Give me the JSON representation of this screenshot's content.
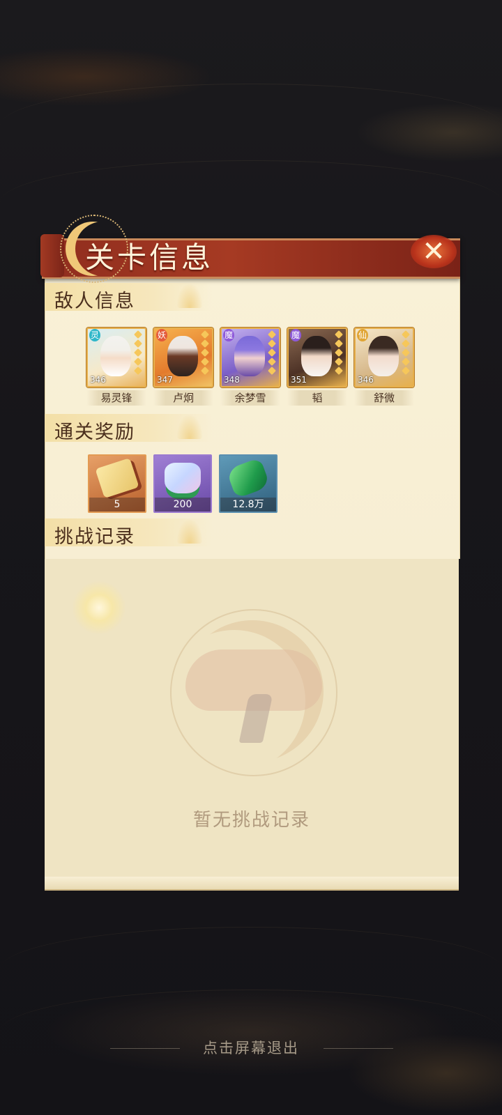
{
  "dialog": {
    "title": "关卡信息",
    "close_icon": "close-x-icon"
  },
  "enemy_section": {
    "title": "敌人信息",
    "heroes": [
      {
        "name": "易灵锋",
        "level": "346",
        "faction": "灵",
        "faction_color": "#2fb7c9"
      },
      {
        "name": "卢炯",
        "level": "347",
        "faction": "妖",
        "faction_color": "#e45a3a"
      },
      {
        "name": "余梦雪",
        "level": "348",
        "faction": "魔",
        "faction_color": "#8e5ad9"
      },
      {
        "name": "韬",
        "level": "351",
        "faction": "魔",
        "faction_color": "#8e5ad9"
      },
      {
        "name": "舒微",
        "level": "346",
        "faction": "仙",
        "faction_color": "#e0a534"
      }
    ]
  },
  "reward_section": {
    "title": "通关奖励",
    "rewards": [
      {
        "icon": "scroll-icon",
        "count": "5",
        "frame": "#e39a52"
      },
      {
        "icon": "crystal-icon",
        "count": "200",
        "frame": "#9b7ad0"
      },
      {
        "icon": "jade-icon",
        "count": "12.8万",
        "frame": "#5a8fb0"
      }
    ]
  },
  "record_section": {
    "title": "挑战记录",
    "empty_text": "暂无挑战记录"
  },
  "footer": {
    "exit_hint": "点击屏幕退出"
  }
}
